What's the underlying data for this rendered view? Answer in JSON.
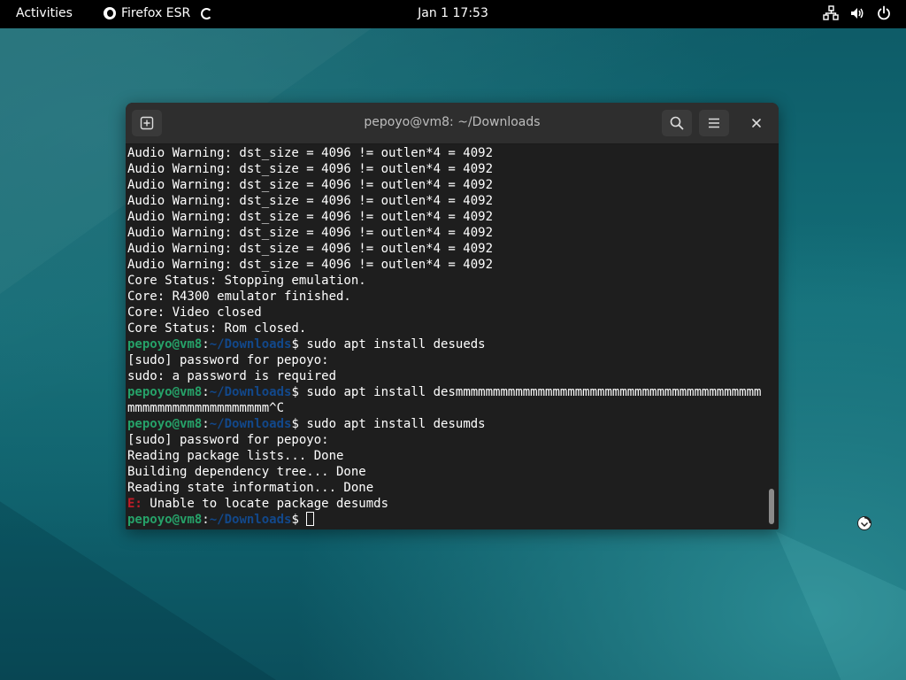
{
  "topbar": {
    "activities": "Activities",
    "app_name": "Firefox ESR",
    "clock": "Jan 1  17:53",
    "tray_icons": [
      "network-icon",
      "volume-icon",
      "power-icon"
    ]
  },
  "terminal": {
    "title": "pepoyo@vm8: ~/Downloads",
    "buttons": [
      "new-tab-icon",
      "search-icon",
      "hamburger-menu-icon",
      "close-icon"
    ],
    "prompt": {
      "user": "pepoyo@vm8",
      "sep": ":",
      "path": "~/Downloads",
      "symbol": "$ "
    },
    "lines": [
      {
        "type": "text",
        "text": "Audio Warning: dst_size = 4096 != outlen*4 = 4092"
      },
      {
        "type": "text",
        "text": "Audio Warning: dst_size = 4096 != outlen*4 = 4092"
      },
      {
        "type": "text",
        "text": "Audio Warning: dst_size = 4096 != outlen*4 = 4092"
      },
      {
        "type": "text",
        "text": "Audio Warning: dst_size = 4096 != outlen*4 = 4092"
      },
      {
        "type": "text",
        "text": "Audio Warning: dst_size = 4096 != outlen*4 = 4092"
      },
      {
        "type": "text",
        "text": "Audio Warning: dst_size = 4096 != outlen*4 = 4092"
      },
      {
        "type": "text",
        "text": "Audio Warning: dst_size = 4096 != outlen*4 = 4092"
      },
      {
        "type": "text",
        "text": "Audio Warning: dst_size = 4096 != outlen*4 = 4092"
      },
      {
        "type": "text",
        "text": "Core Status: Stopping emulation."
      },
      {
        "type": "text",
        "text": "Core: R4300 emulator finished."
      },
      {
        "type": "text",
        "text": "Core: Video closed"
      },
      {
        "type": "text",
        "text": "Core Status: Rom closed."
      },
      {
        "type": "prompt",
        "text": "sudo apt install desueds"
      },
      {
        "type": "text",
        "text": "[sudo] password for pepoyo:"
      },
      {
        "type": "text",
        "text": "sudo: a password is required"
      },
      {
        "type": "prompt",
        "text": "sudo apt install desmmmmmmmmmmmmmmmmmmmmmmmmmmmmmmmmmmmmmmmmm"
      },
      {
        "type": "text",
        "text": "mmmmmmmmmmmmmmmmmmm^C"
      },
      {
        "type": "prompt",
        "text": "sudo apt install desumds"
      },
      {
        "type": "text",
        "text": "[sudo] password for pepoyo:"
      },
      {
        "type": "text",
        "text": "Reading package lists... Done"
      },
      {
        "type": "text",
        "text": "Building dependency tree... Done"
      },
      {
        "type": "text",
        "text": "Reading state information... Done"
      },
      {
        "type": "error",
        "label": "E:",
        "text": " Unable to locate package desumds"
      },
      {
        "type": "input",
        "text": ""
      }
    ]
  },
  "colors": {
    "prompt_user": "#26a269",
    "prompt_path": "#12488b",
    "error": "#c01c28",
    "terminal_bg": "#1e1e1e",
    "topbar_bg": "#000000"
  }
}
